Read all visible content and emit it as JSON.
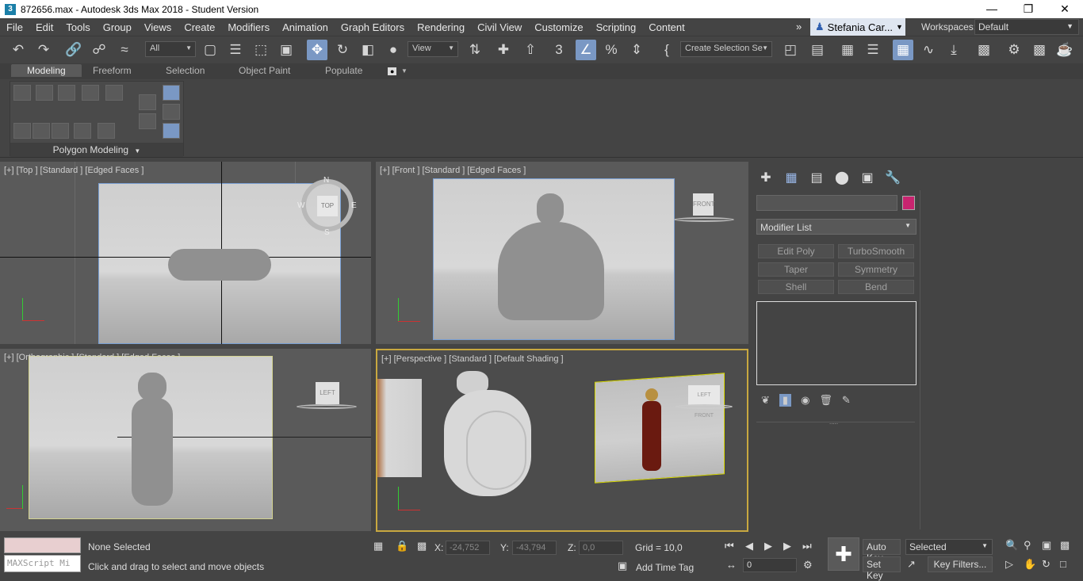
{
  "titlebar": {
    "app_icon": "3",
    "title": "872656.max - Autodesk 3ds Max 2018 - Student Version",
    "minimize": "—",
    "restore": "❐",
    "close": "✕"
  },
  "menubar": {
    "items": [
      "File",
      "Edit",
      "Tools",
      "Group",
      "Views",
      "Create",
      "Modifiers",
      "Animation",
      "Graph Editors",
      "Rendering",
      "Civil View",
      "Customize",
      "Scripting",
      "Content"
    ],
    "overflow": "»",
    "user": "Stefania Car...",
    "workspaces_label": "Workspaces:",
    "workspace_value": "Default"
  },
  "toolbar": {
    "filter_value": "All",
    "refcoord_value": "View",
    "selection_set_placeholder": "Create Selection Se"
  },
  "ribbon": {
    "tabs": [
      "Modeling",
      "Freeform",
      "Selection",
      "Object Paint",
      "Populate"
    ],
    "panel_label": "Polygon Modeling"
  },
  "viewports": {
    "top": {
      "label": "[+] [Top ] [Standard ] [Edged Faces ]",
      "compass": {
        "n": "N",
        "s": "S",
        "e": "E",
        "w": "W",
        "cube": "TOP"
      }
    },
    "front": {
      "label": "[+] [Front ] [Standard ] [Edged Faces ]",
      "cube": "FRONT"
    },
    "ortho": {
      "label": "[+] [Orthographic ] [Standard ] [Edged Faces ]",
      "cube": "LEFT"
    },
    "persp": {
      "label": "[+] [Perspective ] [Standard ] [Default Shading ]",
      "cube": "LEFT FRONT"
    }
  },
  "command_panel": {
    "modifier_list": "Modifier List",
    "buttons": [
      "Edit Poly",
      "TurboSmooth",
      "Taper",
      "Symmetry",
      "Shell",
      "Bend"
    ],
    "swatch_color": "#c8246f",
    "separator": "....."
  },
  "statusbar": {
    "maxscript": "MAXScript Mi",
    "selection_status": "None Selected",
    "prompt": "Click and drag to select and move objects",
    "x_label": "X:",
    "x_value": "-24,752",
    "y_label": "Y:",
    "y_value": "-43,794",
    "z_label": "Z:",
    "z_value": "0,0",
    "grid": "Grid = 10,0",
    "add_time_tag": "Add Time Tag",
    "auto_key": "Auto Key",
    "set_key": "Set Key",
    "selected_value": "Selected",
    "key_filters": "Key Filters...",
    "frame_value": "0"
  }
}
